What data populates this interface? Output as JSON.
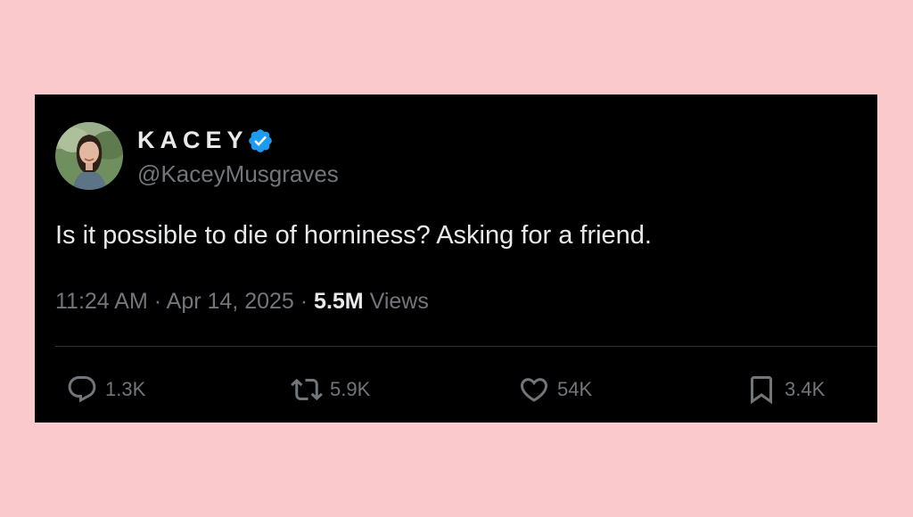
{
  "tweet": {
    "author": {
      "display_name": "KACEY",
      "handle": "@KaceyMusgraves",
      "verified": true,
      "avatar_icon": "profile-photo"
    },
    "text": "Is it possible to die of horniness? Asking for a friend.",
    "meta": {
      "time": "11:24 AM",
      "separator": "·",
      "date": "Apr 14, 2025",
      "views_count": "5.5M",
      "views_label": "Views"
    },
    "actions": {
      "replies": "1.3K",
      "retweets": "5.9K",
      "likes": "54K",
      "bookmarks": "3.4K"
    }
  },
  "colors": {
    "background": "#f9c9cb",
    "card": "#000000",
    "text_primary": "#e7e9ea",
    "text_secondary": "#71767b",
    "verified_blue": "#1d9bf0",
    "divider": "#2f3336"
  }
}
